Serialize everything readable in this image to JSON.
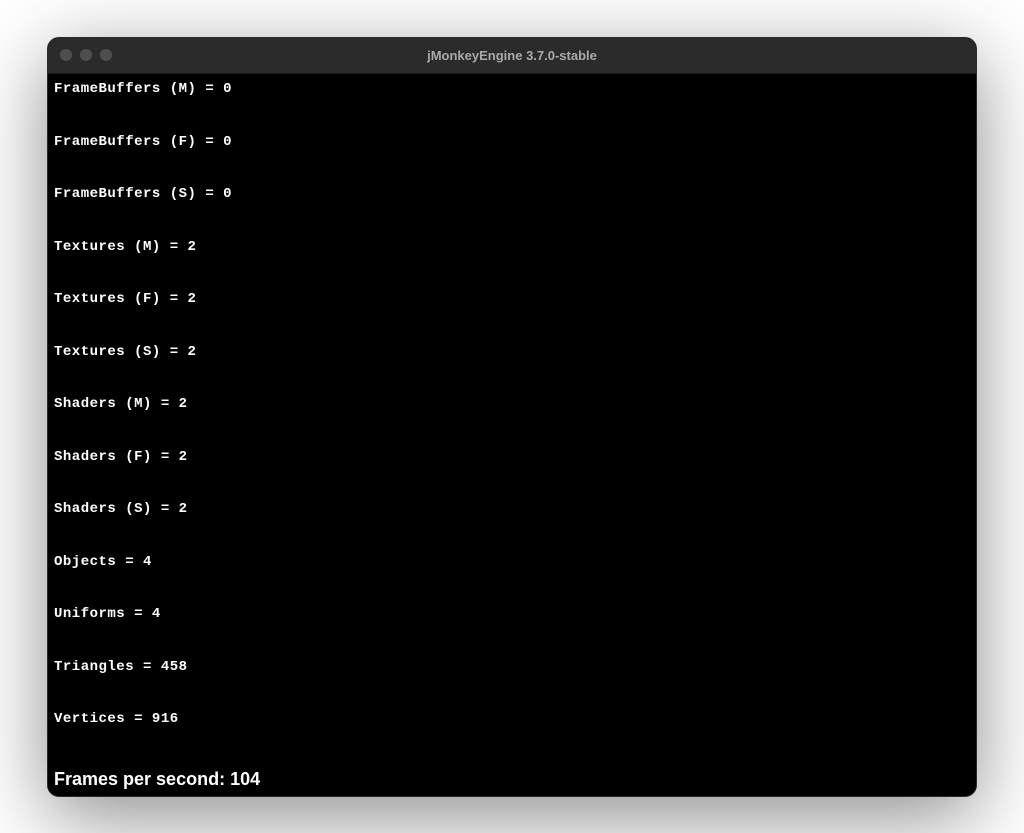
{
  "window": {
    "title": "jMonkeyEngine 3.7.0-stable"
  },
  "stats": {
    "lines": [
      "FrameBuffers (M) = 0",
      "FrameBuffers (F) = 0",
      "FrameBuffers (S) = 0",
      "Textures (M) = 2",
      "Textures (F) = 2",
      "Textures (S) = 2",
      "Shaders (M) = 2",
      "Shaders (F) = 2",
      "Shaders (S) = 2",
      "Objects = 4",
      "Uniforms = 4",
      "Triangles = 458",
      "Vertices = 916"
    ]
  },
  "fps": {
    "label": "Frames per second: 104"
  }
}
